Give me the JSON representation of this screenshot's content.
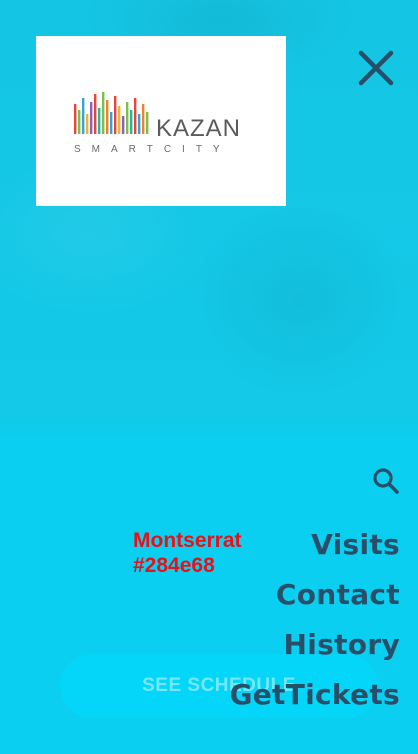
{
  "logo": {
    "brand": "KAZAN",
    "tagline": "SMARTCITY"
  },
  "annotation": {
    "font_line": "Montserrat",
    "color_line": "#284e68"
  },
  "menu": {
    "items": [
      {
        "label": "Visits"
      },
      {
        "label": "Contact"
      },
      {
        "label": "History"
      },
      {
        "label": "GetTickets"
      }
    ]
  },
  "cta": {
    "label": "SEE SCHEDULE"
  },
  "colors": {
    "background": "#12c8e6",
    "menu_text": "#284e68",
    "annotation": "#e8111a",
    "cta": "#03d6f8"
  },
  "icons": {
    "close": "close-icon",
    "search": "search-icon"
  }
}
